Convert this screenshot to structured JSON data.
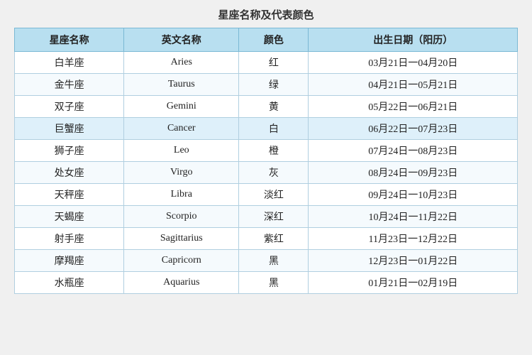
{
  "title": "星座名称及代表颜色",
  "headers": [
    "星座名称",
    "英文名称",
    "颜色",
    "出生日期（阳历）"
  ],
  "rows": [
    {
      "chinese": "白羊座",
      "english": "Aries",
      "color": "红",
      "date": "03月21日一04月20日",
      "highlight": false
    },
    {
      "chinese": "金牛座",
      "english": "Taurus",
      "color": "绿",
      "date": "04月21日一05月21日",
      "highlight": false
    },
    {
      "chinese": "双子座",
      "english": "Gemini",
      "color": "黄",
      "date": "05月22日一06月21日",
      "highlight": false
    },
    {
      "chinese": "巨蟹座",
      "english": "Cancer",
      "color": "白",
      "date": "06月22日一07月23日",
      "highlight": true
    },
    {
      "chinese": "狮子座",
      "english": "Leo",
      "color": "橙",
      "date": "07月24日一08月23日",
      "highlight": false
    },
    {
      "chinese": "处女座",
      "english": "Virgo",
      "color": "灰",
      "date": "08月24日一09月23日",
      "highlight": false
    },
    {
      "chinese": "天秤座",
      "english": "Libra",
      "color": "淡红",
      "date": "09月24日一10月23日",
      "highlight": false
    },
    {
      "chinese": "天蝎座",
      "english": "Scorpio",
      "color": "深红",
      "date": "10月24日一11月22日",
      "highlight": false
    },
    {
      "chinese": "射手座",
      "english": "Sagittarius",
      "color": "紫红",
      "date": "11月23日一12月22日",
      "highlight": false
    },
    {
      "chinese": "摩羯座",
      "english": "Capricorn",
      "color": "黑",
      "date": "12月23日一01月22日",
      "highlight": false
    },
    {
      "chinese": "水瓶座",
      "english": "Aquarius",
      "color": "黑",
      "date": "01月21日一02月19日",
      "highlight": false
    }
  ]
}
